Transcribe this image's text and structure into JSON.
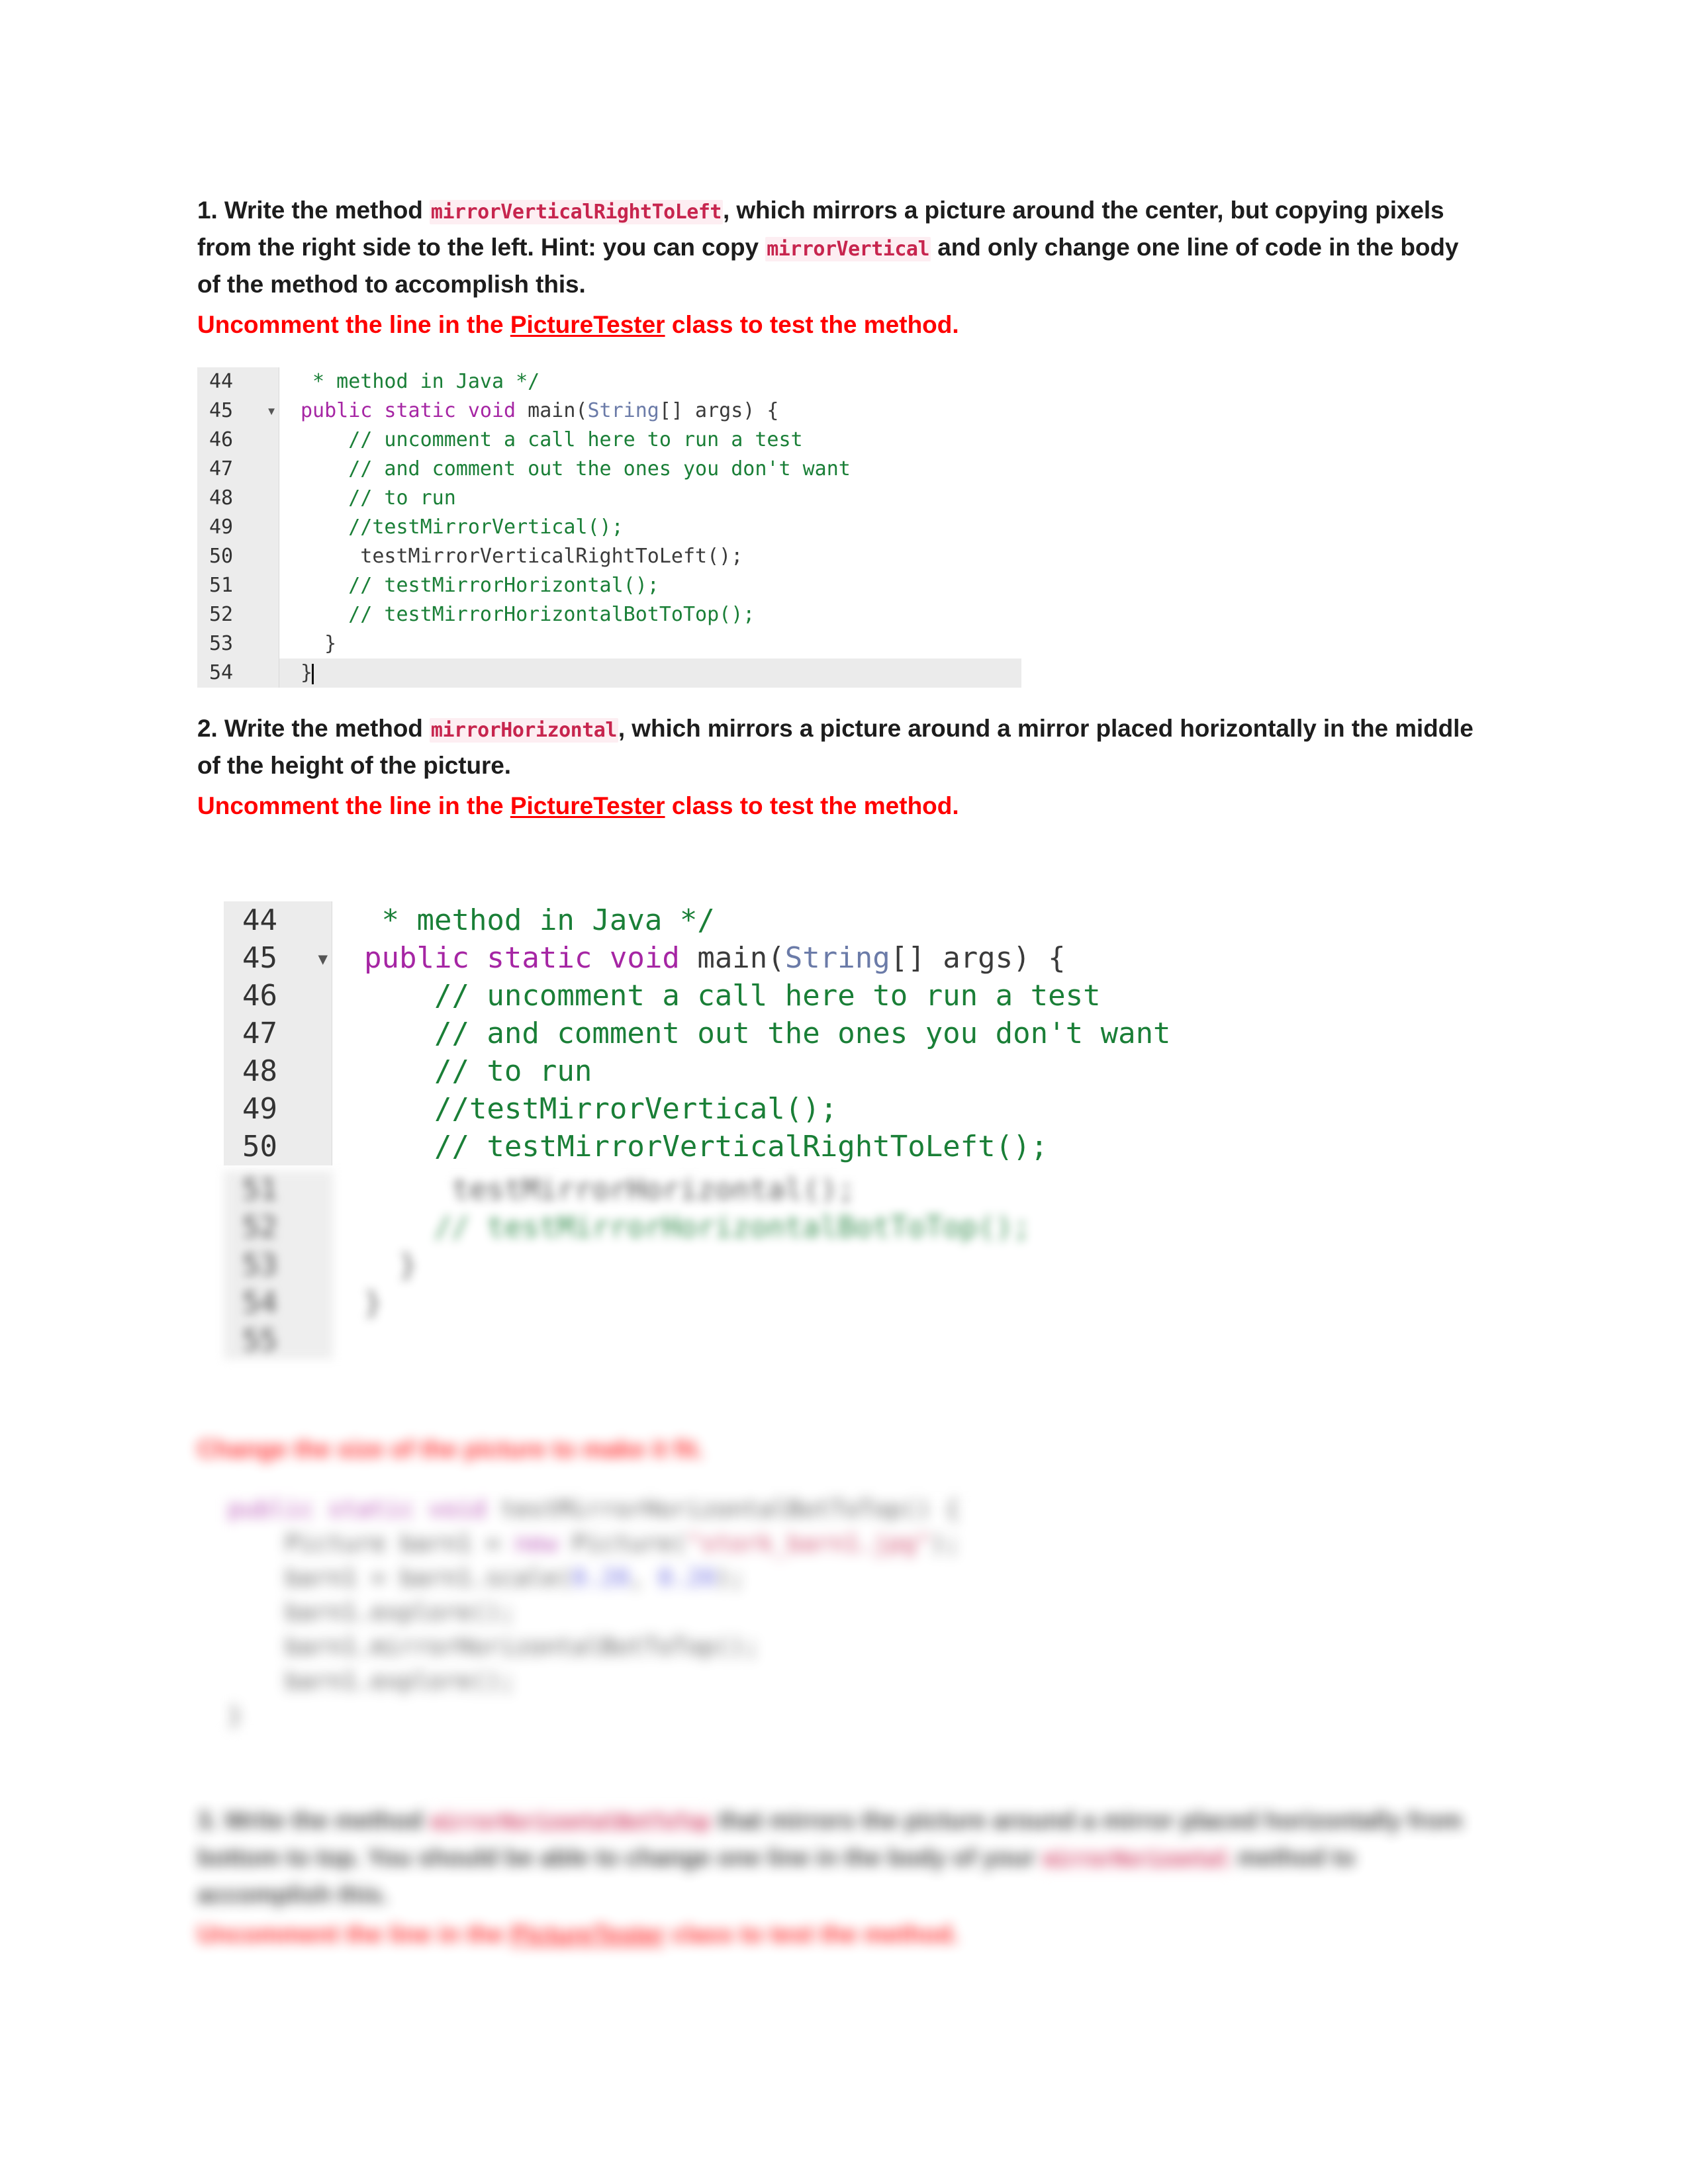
{
  "document": {
    "background": "#ffffff",
    "accent_red": "#ff0000",
    "inline_code_color": "#c7254e",
    "inline_code_bg": "#fdeef2",
    "comment_color": "#1a7f37",
    "keyword_color": "#a626a4",
    "class_color": "#6b7ba8",
    "gutter_bg": "#ececec"
  },
  "item1": {
    "number": "1. ",
    "lead": "Write the method ",
    "code1": "mirrorVerticalRightToLeft",
    "mid": ", which mirrors a picture around the center, but copying pixels from the right side to the left. Hint: you can copy ",
    "code2": "mirrorVertical",
    "tail": " and only change one line of code in the body of the method to accomplish this.",
    "note_before": "Uncomment the line in the ",
    "note_link": "PictureTester",
    "note_after": " class to test the method."
  },
  "item2": {
    "number": "2. ",
    "lead": "Write the method ",
    "code1": "mirrorHorizontal",
    "tail": ", which mirrors a picture around a mirror placed horizontally in the middle of the height of the picture.",
    "note_before": "Uncomment the line in the ",
    "note_link": "PictureTester",
    "note_after": " class to test the method."
  },
  "item3": {
    "number": "3. ",
    "lead": "Write the method ",
    "code1": "mirrorHorizontalBotToTop",
    "mid": " that mirrors the picture around a mirror placed horizontally from bottom to top. You should be able to change one line in the body of your ",
    "code2": "mirrorHorizontal",
    "tail": " method to accomplish this.",
    "note_before": "Uncomment the line in the ",
    "note_link": "PictureTester",
    "note_after": " class to test the method."
  },
  "resize_note": {
    "text": "Change the size of the picture to make it fit."
  },
  "code_block_1": {
    "caption": "PictureTester main method source, lines 44-54",
    "current_line": "54",
    "lines": [
      {
        "num": "44",
        "fold": false,
        "tokens": [
          {
            "t": " * method in Java */",
            "c": "cm"
          }
        ]
      },
      {
        "num": "45",
        "fold": true,
        "tokens": [
          {
            "t": "public static void ",
            "c": "kw"
          },
          {
            "t": "main(",
            "c": "pl"
          },
          {
            "t": "String",
            "c": "cls"
          },
          {
            "t": "[] args) {",
            "c": "pl"
          }
        ]
      },
      {
        "num": "46",
        "fold": false,
        "tokens": [
          {
            "t": "    // uncomment a call here to run a test",
            "c": "cm"
          }
        ]
      },
      {
        "num": "47",
        "fold": false,
        "tokens": [
          {
            "t": "    // and comment out the ones you don't want",
            "c": "cm"
          }
        ]
      },
      {
        "num": "48",
        "fold": false,
        "tokens": [
          {
            "t": "    // to run",
            "c": "cm"
          }
        ]
      },
      {
        "num": "49",
        "fold": false,
        "tokens": [
          {
            "t": "    //testMirrorVertical();",
            "c": "cm"
          }
        ]
      },
      {
        "num": "50",
        "fold": false,
        "tokens": [
          {
            "t": "     testMirrorVerticalRightToLeft();",
            "c": "pl"
          }
        ]
      },
      {
        "num": "51",
        "fold": false,
        "tokens": [
          {
            "t": "    // testMirrorHorizontal();",
            "c": "cm"
          }
        ]
      },
      {
        "num": "52",
        "fold": false,
        "tokens": [
          {
            "t": "    // testMirrorHorizontalBotToTop();",
            "c": "cm"
          }
        ]
      },
      {
        "num": "53",
        "fold": false,
        "tokens": [
          {
            "t": "  }",
            "c": "pl"
          }
        ]
      },
      {
        "num": "54",
        "fold": false,
        "current": true,
        "tokens": [
          {
            "t": "}",
            "c": "pl"
          }
        ]
      }
    ]
  },
  "code_block_2": {
    "caption": "PictureTester main method source, zoomed, lines 44-50",
    "lines": [
      {
        "num": "44",
        "fold": false,
        "clipped": true,
        "tokens": [
          {
            "t": " * method in Java */",
            "c": "cm"
          }
        ]
      },
      {
        "num": "45",
        "fold": true,
        "tokens": [
          {
            "t": "public static void ",
            "c": "kw"
          },
          {
            "t": "main(",
            "c": "pl"
          },
          {
            "t": "String",
            "c": "cls"
          },
          {
            "t": "[] args) {",
            "c": "pl"
          }
        ]
      },
      {
        "num": "46",
        "fold": false,
        "tokens": [
          {
            "t": "    // uncomment a call here to run a test",
            "c": "cm"
          }
        ]
      },
      {
        "num": "47",
        "fold": false,
        "tokens": [
          {
            "t": "    // and comment out the ones you don't want",
            "c": "cm"
          }
        ]
      },
      {
        "num": "48",
        "fold": false,
        "tokens": [
          {
            "t": "    // to run",
            "c": "cm"
          }
        ]
      },
      {
        "num": "49",
        "fold": false,
        "tokens": [
          {
            "t": "    //testMirrorVertical();",
            "c": "cm"
          }
        ]
      },
      {
        "num": "50",
        "fold": false,
        "tokens": [
          {
            "t": "    // testMirrorVerticalRightToLeft();",
            "c": "cm"
          }
        ]
      }
    ]
  },
  "code_block_3": {
    "caption": "PictureTester main method source continued, blurred, lines 51-55",
    "lines": [
      {
        "num": "51",
        "fold": false,
        "tokens": [
          {
            "t": "     testMirrorHorizontal();",
            "c": "pl"
          }
        ]
      },
      {
        "num": "52",
        "fold": false,
        "tokens": [
          {
            "t": "    // testMirrorHorizontalBotToTop();",
            "c": "cm"
          }
        ]
      },
      {
        "num": "53",
        "fold": false,
        "tokens": [
          {
            "t": "  }",
            "c": "pl"
          }
        ]
      },
      {
        "num": "54",
        "fold": false,
        "tokens": [
          {
            "t": "}",
            "c": "pl"
          }
        ]
      },
      {
        "num": "55",
        "fold": false,
        "tokens": [
          {
            "t": "",
            "c": "pl"
          }
        ]
      }
    ]
  },
  "code_block_4": {
    "caption": "testMirrorHorizontalBotToTop method, blurred",
    "lines": [
      {
        "tokens": [
          {
            "t": "public static void ",
            "c": "kw"
          },
          {
            "t": "testMirrorHorizontalBotToTop() {",
            "c": "pl"
          }
        ]
      },
      {
        "tokens": [
          {
            "t": "    Picture barn1 = ",
            "c": "pl"
          },
          {
            "t": "new ",
            "c": "kw"
          },
          {
            "t": "Picture(",
            "c": "pl"
          },
          {
            "t": "\"stork_barn1.jpg\"",
            "c": "str"
          },
          {
            "t": ");",
            "c": "pl"
          }
        ]
      },
      {
        "tokens": [
          {
            "t": "    barn1 = barn1.scale(",
            "c": "pl"
          },
          {
            "t": "0.20",
            "c": "num"
          },
          {
            "t": ", ",
            "c": "pl"
          },
          {
            "t": "0.20",
            "c": "num"
          },
          {
            "t": ");",
            "c": "pl"
          }
        ]
      },
      {
        "tokens": [
          {
            "t": "    barn1.explore();",
            "c": "pl"
          }
        ]
      },
      {
        "tokens": [
          {
            "t": "    barn1.mirrorHorizontalBotToTop();",
            "c": "pl"
          }
        ]
      },
      {
        "tokens": [
          {
            "t": "    barn1.explore();",
            "c": "pl"
          }
        ]
      },
      {
        "tokens": [
          {
            "t": "",
            "c": "pl"
          }
        ]
      },
      {
        "tokens": [
          {
            "t": "}",
            "c": "pl"
          }
        ]
      }
    ]
  }
}
